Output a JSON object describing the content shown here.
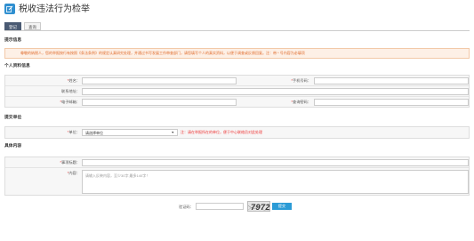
{
  "header": {
    "title": "税收违法行为检举"
  },
  "tabs": [
    {
      "label": "登记"
    },
    {
      "label": "查询"
    }
  ],
  "sections": {
    "notice_title": "提示信息",
    "personal_title": "个人资料信息",
    "unit_title": "提交单位",
    "content_title": "具体内容"
  },
  "notice": {
    "text": "尊敬的纳税人，您的举报按行有按照《条法条例》的规定认真研究处理，并通过书写发展工作审查部门，请您填写个人的真实资料，以便于调查或反馈回复。注：带 * 号内容为必填项"
  },
  "personal": {
    "name_label": "姓名：",
    "phone_label": "手机号码：",
    "address_label": "联系地址：",
    "email_label": "电子邮箱：",
    "query_pwd_label": "查询密码："
  },
  "unit": {
    "label": "单位：",
    "select_value": "请选择单位",
    "warning": "注：请在举报所在的单位，便于中心联络员对此处理"
  },
  "content": {
    "subject_label": "事项标题：",
    "body_label": "内容：",
    "body_placeholder": "请输入反映内容，至少30字,最多140字！"
  },
  "captcha": {
    "label": "验证码：",
    "image_text": "7972"
  },
  "submit": {
    "label": "提交"
  },
  "colors": {
    "accent": "#2b9bd6",
    "warning": "#e33333",
    "notice_text": "#e06c2c",
    "tab_active": "#4a5a73"
  }
}
